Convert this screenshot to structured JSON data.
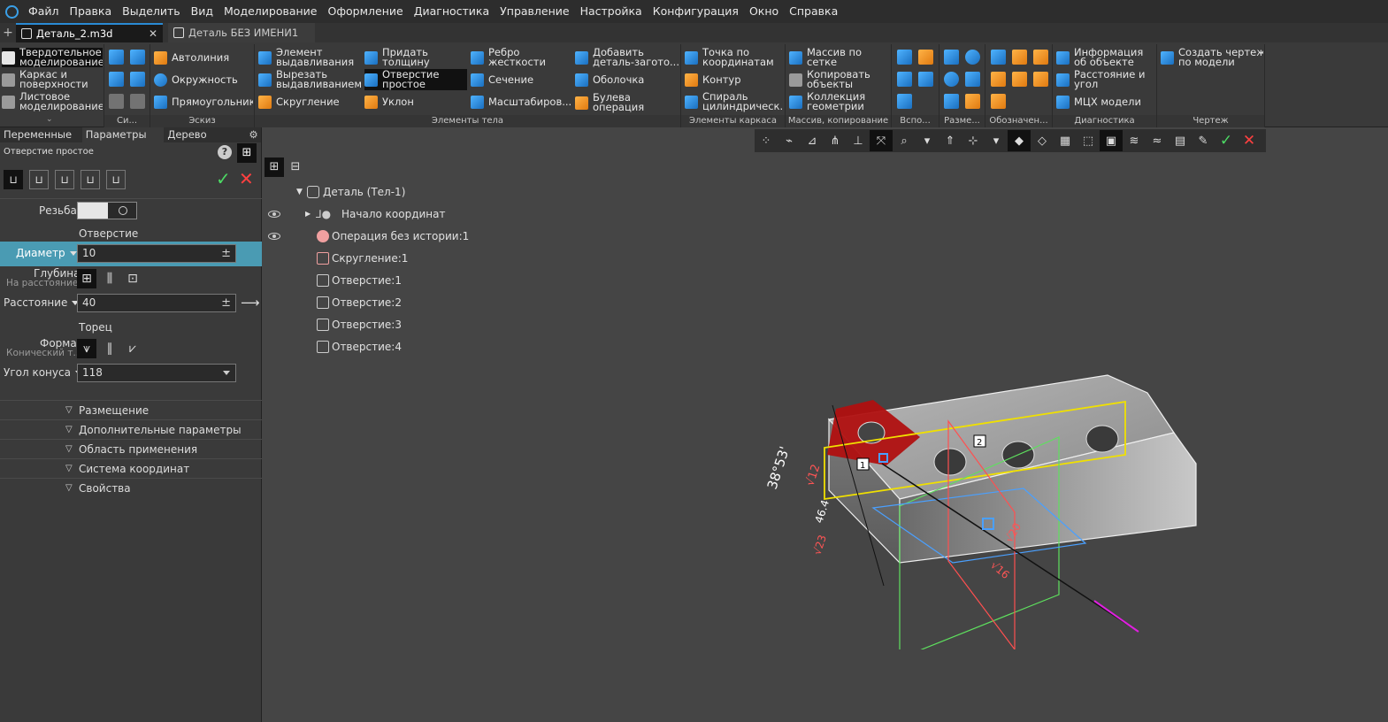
{
  "menubar": {
    "items": [
      "Файл",
      "Правка",
      "Выделить",
      "Вид",
      "Моделирование",
      "Оформление",
      "Диагностика",
      "Управление",
      "Настройка",
      "Конфигурация",
      "Окно",
      "Справка"
    ]
  },
  "tabs": [
    {
      "label": "Деталь_2.m3d",
      "active": true,
      "close": "✕"
    },
    {
      "label": "Деталь БЕЗ ИМЕНИ1",
      "active": false
    }
  ],
  "ribbon": {
    "modes": [
      "Твердотельное моделирование",
      "Каркас и поверхности",
      "Листовое моделирование"
    ],
    "groups": {
      "system": "Си...",
      "sketch": "Эскиз",
      "body": "Элементы тела",
      "frame": "Элементы каркаса",
      "array": "Массив, копирование",
      "aux": "Вспо...",
      "dims": "Разме...",
      "notation": "Обозначен...",
      "diag": "Диагностика",
      "drawing": "Чертеж"
    },
    "sketch_buttons": [
      "Автолиния",
      "Окружность",
      "Прямоугольник"
    ],
    "body_buttons": [
      [
        "Элемент",
        "выдавливания"
      ],
      [
        "Вырезать",
        "выдавливанием"
      ],
      [
        "Скругление"
      ],
      [
        "Придать",
        "толщину"
      ],
      [
        "Отверстие",
        "простое"
      ],
      [
        "Уклон"
      ],
      [
        "Ребро",
        "жесткости"
      ],
      [
        "Сечение"
      ],
      [
        "Масштабиров..."
      ],
      [
        "Добавить",
        "деталь-загото..."
      ],
      [
        "Оболочка"
      ],
      [
        "Булева",
        "операция"
      ]
    ],
    "frame_buttons": [
      [
        "Точка по",
        "координатам"
      ],
      [
        "Контур"
      ],
      [
        "Спираль",
        "цилиндрическ..."
      ]
    ],
    "array_buttons": [
      [
        "Массив по",
        "сетке"
      ],
      [
        "Копировать",
        "объекты"
      ],
      [
        "Коллекция",
        "геометрии"
      ]
    ],
    "diag_buttons": [
      [
        "Информация",
        "об объекте"
      ],
      [
        "Расстояние и",
        "угол"
      ],
      [
        "МЦХ модели"
      ]
    ],
    "drawing_buttons": [
      [
        "Создать чертеж",
        "по модели"
      ]
    ]
  },
  "left_panel": {
    "tabs": [
      "Переменные",
      "Параметры",
      "Дерево"
    ],
    "title": "Отверстие простое",
    "help": "?",
    "thread_label": "Резьба:",
    "hole_header": "Отверстие",
    "diameter_label": "Диаметр",
    "diameter_value": "10",
    "depth_label": "Глубина:",
    "depth_sub": "На расстояние",
    "distance_label": "Расстояние",
    "distance_value": "40",
    "end_header": "Торец",
    "shape_label": "Форма:",
    "shape_sub": "Конический т...",
    "cone_label": "Угол конуса",
    "cone_value": "118",
    "pm": "±",
    "sections": [
      "Размещение",
      "Дополнительные параметры",
      "Область применения",
      "Система координат",
      "Свойства"
    ]
  },
  "tree": {
    "root": "Деталь (Тел-1)",
    "items": [
      "Начало координат",
      "Операция без истории:1",
      "Скругление:1",
      "Отверстие:1",
      "Отверстие:2",
      "Отверстие:3",
      "Отверстие:4"
    ]
  },
  "model": {
    "dims": [
      "38°53'",
      "√12",
      "46.4",
      "√23",
      "√20",
      "√16"
    ],
    "markers": [
      "1",
      "2"
    ]
  },
  "colors": {
    "accent": "#2a8ad4",
    "highlight_row": "#4a9bb3",
    "ok": "#4cd964",
    "cancel": "#ff4040"
  }
}
